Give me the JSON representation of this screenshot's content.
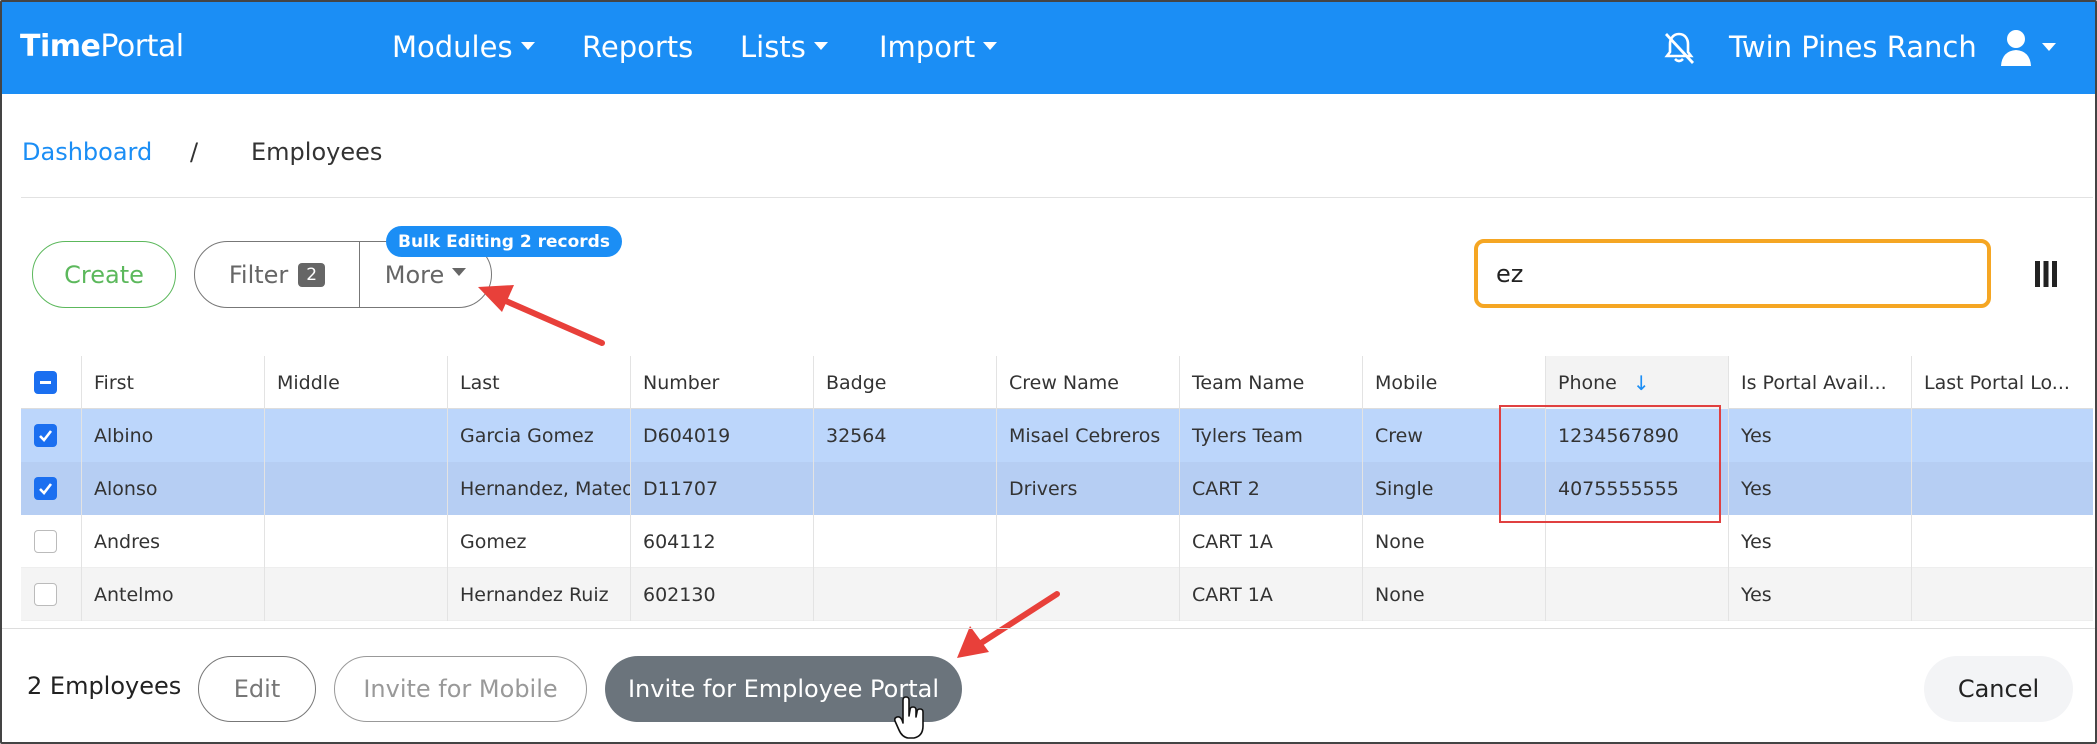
{
  "navbar": {
    "brand_bold": "Time",
    "brand_rest": "Portal",
    "items": [
      {
        "label": "Modules",
        "has_caret": true
      },
      {
        "label": "Reports",
        "has_caret": false
      },
      {
        "label": "Lists",
        "has_caret": true
      },
      {
        "label": "Import",
        "has_caret": true
      }
    ],
    "bell_icon": "bell-slash-icon",
    "org_name": "Twin Pines Ranch",
    "user_icon": "user-icon",
    "color": "#1b8ef5"
  },
  "breadcrumb": {
    "link": "Dashboard",
    "separator": "/",
    "current": "Employees"
  },
  "toolbar": {
    "create_label": "Create",
    "filter_label": "Filter",
    "filter_count": "2",
    "more_label": "More",
    "bulk_badge": "Bulk Editing 2 records",
    "search_value": "ez",
    "columns_icon": "columns-icon"
  },
  "table": {
    "columns": [
      "First",
      "Middle",
      "Last",
      "Number",
      "Badge",
      "Crew Name",
      "Team Name",
      "Mobile",
      "Phone",
      "Is Portal Avail...",
      "Last Portal Lo..."
    ],
    "sort_column": "Phone",
    "sort_direction": "descending",
    "rows": [
      {
        "checked": true,
        "cells": [
          "Albino",
          "",
          "Garcia Gomez",
          "D604019",
          "32564",
          "Misael Cebreros",
          "Tylers Team",
          "Crew",
          "1234567890",
          "Yes",
          ""
        ]
      },
      {
        "checked": true,
        "cells": [
          "Alonso",
          "",
          "Hernandez, Mateo",
          "D11707",
          "",
          "Drivers",
          "CART 2",
          "Single",
          "4075555555",
          "Yes",
          ""
        ]
      },
      {
        "checked": false,
        "cells": [
          "Andres",
          "",
          "Gomez",
          "604112",
          "",
          "",
          "CART 1A",
          "None",
          "",
          "Yes",
          ""
        ]
      },
      {
        "checked": false,
        "cells": [
          "Antelmo",
          "",
          "Hernandez Ruiz",
          "602130",
          "",
          "",
          "CART 1A",
          "None",
          "",
          "Yes",
          ""
        ]
      }
    ]
  },
  "footer": {
    "count_label": "2 Employees",
    "edit_label": "Edit",
    "invite_mobile_label": "Invite for Mobile",
    "invite_portal_label": "Invite for Employee Portal",
    "cancel_label": "Cancel"
  },
  "colors": {
    "primary": "#1b8ef5",
    "success": "#5cb85c",
    "search_border": "#f5a623",
    "selected_row": "#bcd6fb",
    "annotation": "#e04040"
  }
}
